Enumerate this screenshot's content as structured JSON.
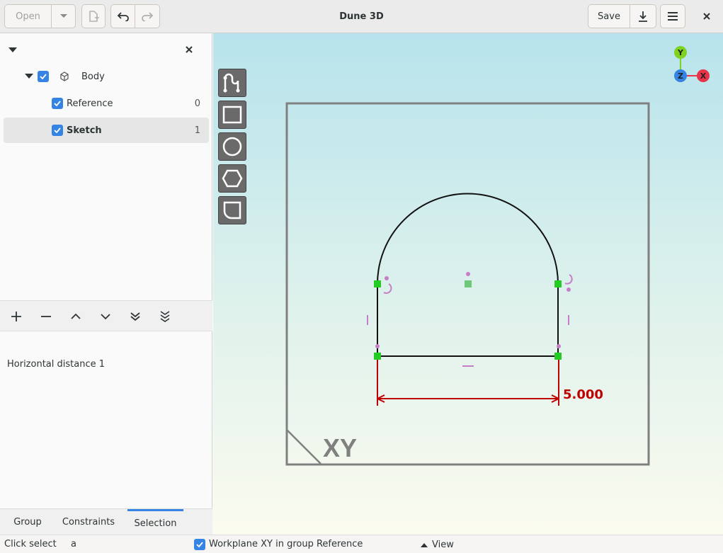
{
  "window": {
    "title": "Dune 3D",
    "open_label": "Open",
    "save_label": "Save"
  },
  "tree": {
    "items": [
      {
        "label": "Body",
        "count": ""
      },
      {
        "label": "Reference",
        "count": "0"
      },
      {
        "label": "Sketch",
        "count": "1"
      }
    ]
  },
  "selection_list": {
    "items": [
      "Horizontal distance 1"
    ]
  },
  "tabs": [
    "Group",
    "Constraints",
    "Selection"
  ],
  "active_tab": "Selection",
  "status": {
    "mode": "Click select",
    "key": "a",
    "workplane": "Workplane XY in group Reference",
    "view": "View"
  },
  "canvas": {
    "workplane_label": "XY",
    "dimension_value": "5.000",
    "axes": {
      "x": "X",
      "y": "Y",
      "z": "Z"
    }
  },
  "colors": {
    "accent": "#3584e4",
    "dimension": "#c00000",
    "point": "#22cc22",
    "constraint": "#c87dc8",
    "axis_x": "#e8334a",
    "axis_y": "#7ed321",
    "axis_z": "#3584e4"
  }
}
